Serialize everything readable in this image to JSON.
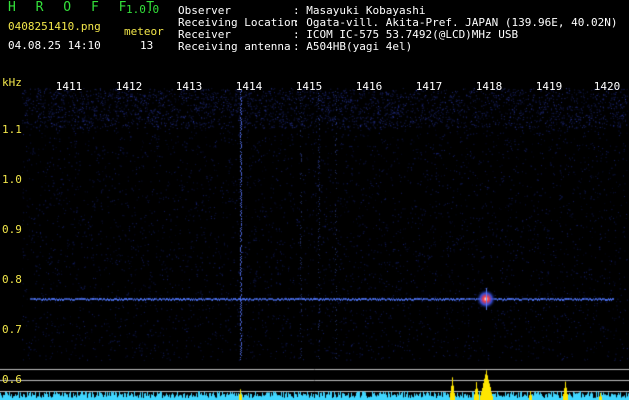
{
  "header": {
    "app_name": "H R O F F T",
    "version": "1.0.0",
    "filename": "0408251410.png",
    "meteor_label": "meteor",
    "meteor_count": "13",
    "datetime": "04.08.25 14:10"
  },
  "info": [
    {
      "label": "Observer",
      "value": ": Masayuki Kobayashi"
    },
    {
      "label": "Receiving Location",
      "value": ": Ogata-vill. Akita-Pref. JAPAN (139.96E, 40.02N)"
    },
    {
      "label": "Receiver",
      "value": ": ICOM IC-575 53.7492(@LCD)MHz USB"
    },
    {
      "label": "Receiving antenna",
      "value": ": A504HB(yagi 4el)"
    }
  ],
  "axes": {
    "x_unit": "kHz",
    "x_ticks": [
      "1411",
      "1412",
      "1413",
      "1414",
      "1415",
      "1416",
      "1417",
      "1418",
      "1419",
      "1420"
    ],
    "y_ticks": [
      "1.1",
      "1.0",
      "0.9",
      "0.8",
      "0.7",
      "0.6"
    ]
  },
  "colors": {
    "background": "#000000",
    "title_green": "#33e03a",
    "label_yellow": "#f2e64a",
    "signal_blue": "#3a5cff",
    "spectrum_cyan": "#3fd6ff",
    "spectrum_yellow": "#ffe600"
  }
}
